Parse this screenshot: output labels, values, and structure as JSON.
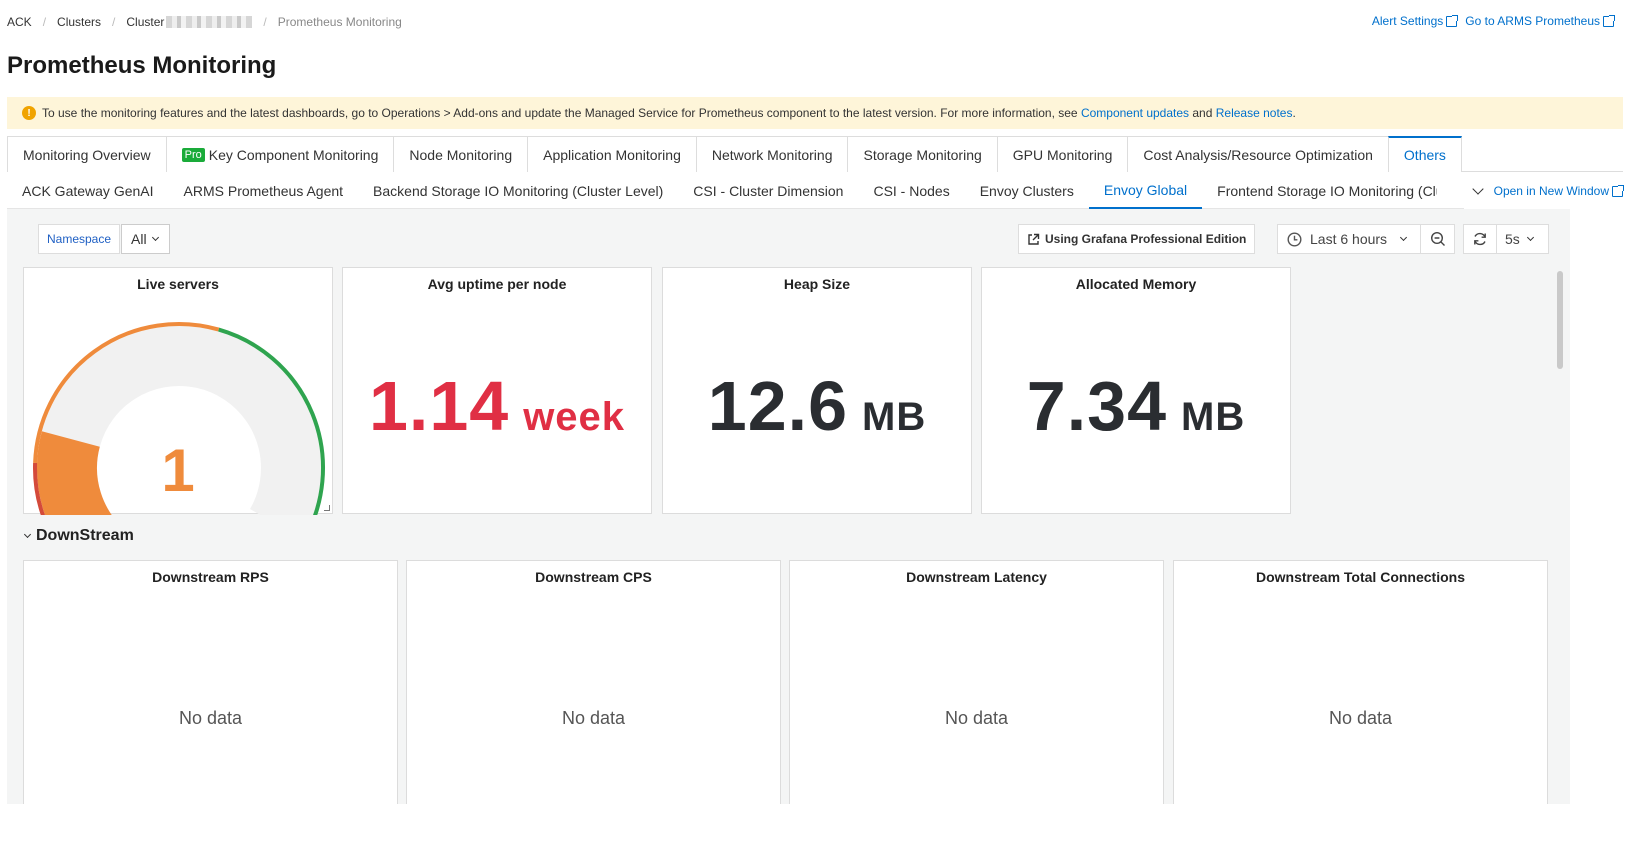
{
  "breadcrumb": {
    "items": [
      "ACK",
      "Clusters",
      "Cluster",
      "Prometheus Monitoring"
    ]
  },
  "toplinks": {
    "alert_settings": "Alert Settings",
    "go_to_arms": "Go to ARMS Prometheus"
  },
  "page": {
    "title": "Prometheus Monitoring"
  },
  "notice": {
    "text": "To use the monitoring features and the latest dashboards, go to Operations > Add-ons and update the Managed Service for Prometheus component to the latest version. For more information, see",
    "link1": "Component updates",
    "middle": "and",
    "link2": "Release notes",
    "end": "."
  },
  "main_tabs": [
    "Monitoring Overview",
    "Key Component Monitoring",
    "Node Monitoring",
    "Application Monitoring",
    "Network Monitoring",
    "Storage Monitoring",
    "GPU Monitoring",
    "Cost Analysis/Resource Optimization",
    "Others"
  ],
  "pro_badge": "Pro",
  "sub_tabs": [
    "ACK Gateway GenAI",
    "ARMS Prometheus Agent",
    "Backend Storage IO Monitoring (Cluster Level)",
    "CSI - Cluster Dimension",
    "CSI - Nodes",
    "Envoy Clusters",
    "Envoy Global",
    "Frontend Storage IO Monitoring (Clu"
  ],
  "open_new_window": "Open in New Window",
  "toolbar": {
    "namespace_label": "Namespace",
    "namespace_value": "All",
    "grafana_pro": "Using Grafana Professional Edition",
    "time_range": "Last 6 hours",
    "refresh_interval": "5s"
  },
  "panels": {
    "live_servers": {
      "title": "Live servers",
      "value": "1",
      "gauge_fraction": 0.25
    },
    "avg_uptime": {
      "title": "Avg uptime per node",
      "value": "1.14",
      "unit": "week"
    },
    "heap_size": {
      "title": "Heap Size",
      "value": "12.6",
      "unit": "MB"
    },
    "allocated_memory": {
      "title": "Allocated Memory",
      "value": "7.34",
      "unit": "MB"
    }
  },
  "section": {
    "title": "DownStream"
  },
  "downstream_panels": [
    {
      "title": "Downstream RPS",
      "status": "No data"
    },
    {
      "title": "Downstream CPS",
      "status": "No data"
    },
    {
      "title": "Downstream Latency",
      "status": "No data"
    },
    {
      "title": "Downstream Total Connections",
      "status": "No data"
    }
  ],
  "colors": {
    "link": "#0070cc",
    "notice_bg": "#fef5d9",
    "gauge_orange": "#ef8b3c",
    "gauge_red": "#d44a3a",
    "gauge_green": "#2fa44f",
    "uptime_red": "#e02f44",
    "stat_dark": "#2a2d31"
  }
}
